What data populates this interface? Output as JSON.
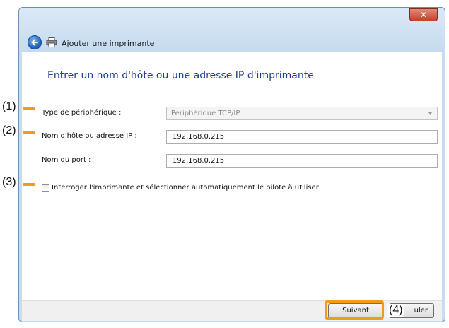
{
  "window": {
    "title": "Ajouter une imprimante",
    "close_symbol": "✕"
  },
  "heading": "Entrer un nom d'hôte ou une adresse IP d'imprimante",
  "form": {
    "device_type_label": "Type de périphérique :",
    "device_type_value": "Périphérique TCP/IP",
    "hostname_label": "Nom d'hôte ou adresse IP :",
    "hostname_value": "192.168.0.215",
    "port_label": "Nom du port :",
    "port_value": "192.168.0.215",
    "query_checkbox_label": "Interroger l'imprimante et sélectionner automatiquement le pilote à utiliser",
    "query_checkbox_checked": false
  },
  "buttons": {
    "next": "Suivant",
    "cancel_partial": "uler"
  },
  "callouts": {
    "c1": "(1)",
    "c2": "(2)",
    "c3": "(3)",
    "c4": "(4)"
  },
  "colors": {
    "accent_orange": "#f29a1b",
    "heading_blue": "#1e3f8f",
    "frame_blue": "#c6dcf1"
  },
  "icons": [
    "back-arrow-icon",
    "printer-icon",
    "close-icon",
    "chevron-down-icon"
  ]
}
